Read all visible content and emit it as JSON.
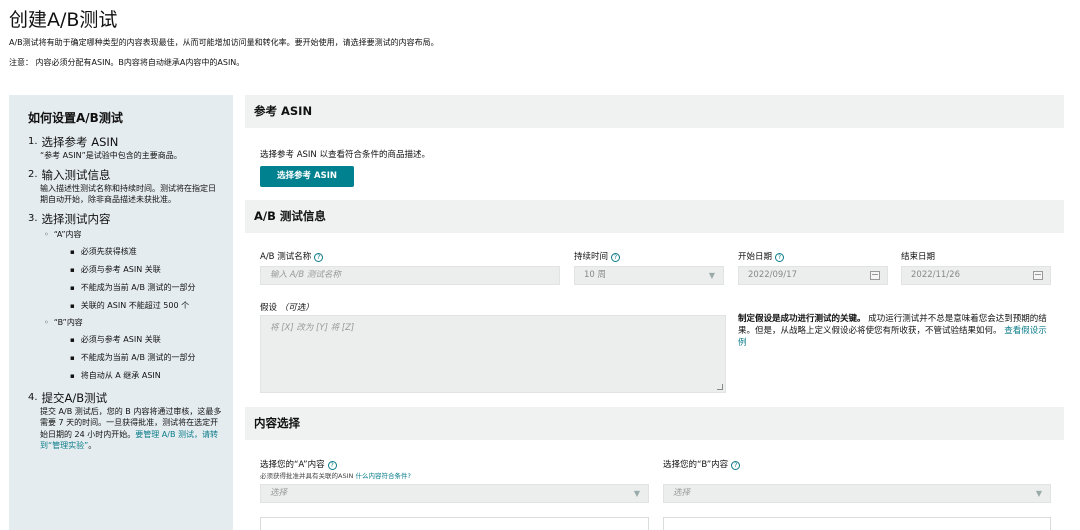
{
  "page": {
    "title": "创建A/B测试",
    "intro": "A/B测试将有助于确定哪种类型的内容表现最佳，从而可能增加访问量和转化率。要开始使用，请选择要测试的内容布局。",
    "note": "注意：  内容必须分配有ASIN。B内容将自动继承A内容中的ASIN。"
  },
  "sidebar": {
    "title": "如何设置A/B测试",
    "steps": [
      {
        "num": "1.",
        "title": "选择参考 ASIN",
        "desc": "“参考 ASIN”是试验中包含的主要商品。"
      },
      {
        "num": "2.",
        "title": "输入测试信息",
        "desc": "输入描述性测试名称和持续时间。测试将在指定日期自动开始，除非商品描述未获批准。"
      },
      {
        "num": "3.",
        "title": "选择测试内容"
      },
      {
        "num": "4.",
        "title": "提交A/B测试",
        "desc": "提交 A/B 测试后，您的 B 内容将通过审核，这最多需要 7 天的时间。一旦获得批准，测试将在选定开始日期的 24 小时内开始。",
        "link": "要管理 A/B 测试，请转到“管理实验”",
        "tail": "。"
      }
    ],
    "content_a": {
      "label": "“A”内容",
      "items": [
        "必须先获得核准",
        "必须与参考 ASIN 关联",
        "不能成为当前 A/B 测试的一部分",
        "关联的 ASIN 不能超过 500 个"
      ]
    },
    "content_b": {
      "label": "“B”内容",
      "items": [
        "必须与参考 ASIN 关联",
        "不能成为当前 A/B 测试的一部分",
        "将自动从 A 继承 ASIN"
      ]
    }
  },
  "ref_asin": {
    "heading": "参考 ASIN",
    "desc": "选择参考 ASIN 以查看符合条件的商品描述。",
    "button": "选择参考 ASIN"
  },
  "test_info": {
    "heading": "A/B 测试信息",
    "name_label": "A/B 测试名称",
    "name_placeholder": "输入 A/B 测试名称",
    "duration_label": "持续时间",
    "duration_value": "10 周",
    "start_label": "开始日期",
    "start_value": "2022/09/17",
    "end_label": "结束日期",
    "end_value": "2022/11/26",
    "hypothesis_label": "假设",
    "hypothesis_optional": "（可选）",
    "hypothesis_placeholder": "将 [X] 改为 [Y] 将 [Z]",
    "hypothesis_bold": "制定假设是成功进行测试的关键。",
    "hypothesis_text": "成功运行测试并不总是意味着您会达到预期的结果。但是，从战略上定义假设必将使您有所收获，不管试验结果如何。",
    "hypothesis_link": "查看假设示例"
  },
  "content_select": {
    "heading": "内容选择",
    "a_label": "选择您的“A”内容",
    "a_note": "必须获得批准并具有关联的ASIN",
    "a_note_link": "什么内容符合条件?",
    "a_placeholder": "选择",
    "b_label": "选择您的“B”内容",
    "b_placeholder": "选择"
  },
  "icons": {
    "help": "help-circle-icon",
    "calendar": "calendar-icon",
    "dropdown": "chevron-down-icon"
  },
  "colors": {
    "accent": "#00818f",
    "sidebar_bg": "#e5ecef",
    "section_bg": "#f0f2f2"
  }
}
